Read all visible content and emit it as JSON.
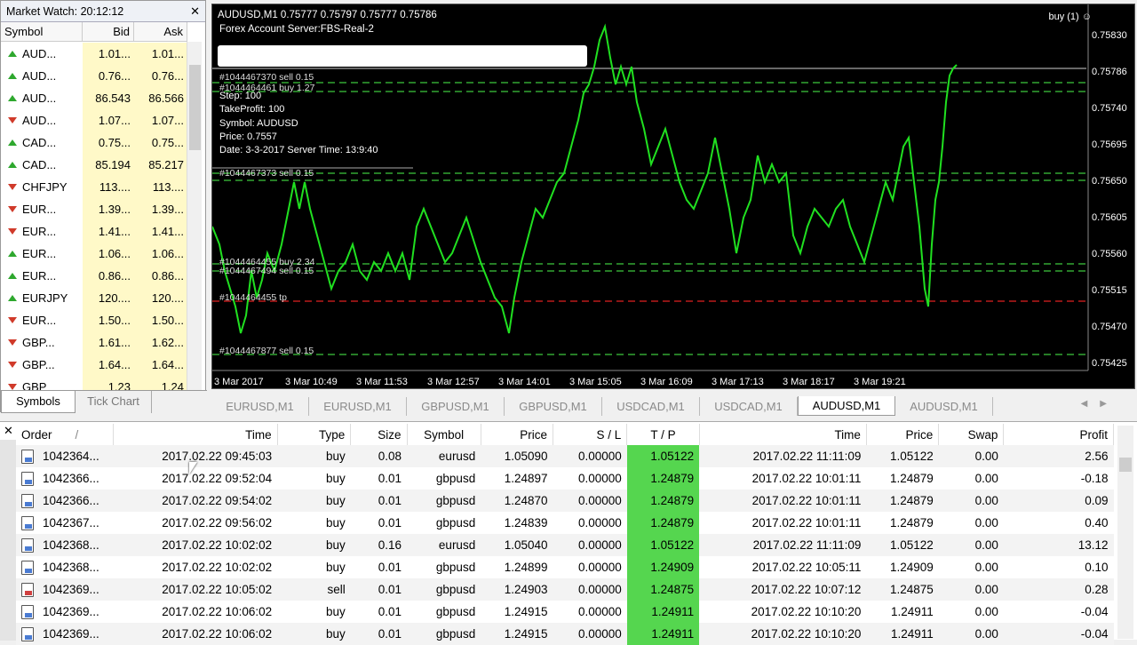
{
  "market_watch": {
    "title": "Market Watch: 20:12:12",
    "headers": {
      "symbol": "Symbol",
      "bid": "Bid",
      "ask": "Ask"
    },
    "rows": [
      {
        "symbol": "AUD...",
        "bid": "1.01...",
        "ask": "1.01...",
        "dir": "up"
      },
      {
        "symbol": "AUD...",
        "bid": "0.76...",
        "ask": "0.76...",
        "dir": "up"
      },
      {
        "symbol": "AUD...",
        "bid": "86.543",
        "ask": "86.566",
        "dir": "up"
      },
      {
        "symbol": "AUD...",
        "bid": "1.07...",
        "ask": "1.07...",
        "dir": "dn"
      },
      {
        "symbol": "CAD...",
        "bid": "0.75...",
        "ask": "0.75...",
        "dir": "up"
      },
      {
        "symbol": "CAD...",
        "bid": "85.194",
        "ask": "85.217",
        "dir": "up"
      },
      {
        "symbol": "CHFJPY",
        "bid": "113....",
        "ask": "113....",
        "dir": "dn"
      },
      {
        "symbol": "EUR...",
        "bid": "1.39...",
        "ask": "1.39...",
        "dir": "dn"
      },
      {
        "symbol": "EUR...",
        "bid": "1.41...",
        "ask": "1.41...",
        "dir": "dn"
      },
      {
        "symbol": "EUR...",
        "bid": "1.06...",
        "ask": "1.06...",
        "dir": "up"
      },
      {
        "symbol": "EUR...",
        "bid": "0.86...",
        "ask": "0.86...",
        "dir": "up"
      },
      {
        "symbol": "EURJPY",
        "bid": "120....",
        "ask": "120....",
        "dir": "up"
      },
      {
        "symbol": "EUR...",
        "bid": "1.50...",
        "ask": "1.50...",
        "dir": "dn"
      },
      {
        "symbol": "GBP...",
        "bid": "1.61...",
        "ask": "1.62...",
        "dir": "dn"
      },
      {
        "symbol": "GBP...",
        "bid": "1.64...",
        "ask": "1.64...",
        "dir": "dn"
      },
      {
        "symbol": "GBP",
        "bid": "1.23",
        "ask": "1.24",
        "dir": "dn"
      }
    ],
    "tabs": [
      "Symbols",
      "Tick Chart"
    ]
  },
  "chart": {
    "title": "AUDUSD,M1  0.75777 0.75797 0.75777 0.75786",
    "server": "Forex Account Server:FBS-Real-2",
    "buy_indicator": "buy (1) ☺",
    "info_lines": [
      "Step: 100",
      "TakeProfit: 100",
      "Symbol: AUDUSD",
      "Price: 0.7557",
      "Date: 3-3-2017 Server Time: 13:9:40"
    ],
    "order_labels": [
      {
        "text": "#1044467370 sell 0.15"
      },
      {
        "text": "#1044464461 buy 1.27"
      },
      {
        "text": "#1044467373 sell 0.15"
      },
      {
        "text": "#1044464455 buy 2.34"
      },
      {
        "text": "#1044467494 sell 0.15"
      },
      {
        "text": "#1044464455 tp"
      },
      {
        "text": "#1044467877 sell 0.15"
      }
    ],
    "price_labels": [
      "0.75830",
      "0.75786",
      "0.75740",
      "0.75695",
      "0.75650",
      "0.75605",
      "0.75560",
      "0.75515",
      "0.75470",
      "0.75425"
    ],
    "time_labels": [
      "3 Mar 2017",
      "3 Mar 10:49",
      "3 Mar 11:53",
      "3 Mar 12:57",
      "3 Mar 14:01",
      "3 Mar 15:05",
      "3 Mar 16:09",
      "3 Mar 17:13",
      "3 Mar 18:17",
      "3 Mar 19:21"
    ],
    "colors": {
      "line": "#20e020",
      "background": "#000000",
      "dashed_green": "#3cc83c",
      "dashed_red": "#e02020"
    }
  },
  "chart_tabs": [
    {
      "label": "EURUSD,M1",
      "active": false
    },
    {
      "label": "EURUSD,M1",
      "active": false
    },
    {
      "label": "GBPUSD,M1",
      "active": false
    },
    {
      "label": "GBPUSD,M1",
      "active": false
    },
    {
      "label": "USDCAD,M1",
      "active": false
    },
    {
      "label": "USDCAD,M1",
      "active": false
    },
    {
      "label": "AUDUSD,M1",
      "active": true
    },
    {
      "label": "AUDUSD,M1",
      "active": false
    }
  ],
  "terminal": {
    "headers": [
      "Order",
      "Time",
      "Type",
      "Size",
      "Symbol",
      "Price",
      "S / L",
      "T / P",
      "Time",
      "Price",
      "Swap",
      "Profit"
    ],
    "sort_indicator": "/",
    "rows": [
      [
        "1042364...",
        "2017.02.22 09:45:03",
        "buy",
        "0.08",
        "eurusd",
        "1.05090",
        "0.00000",
        "1.05122",
        "2017.02.22 11:11:09",
        "1.05122",
        "0.00",
        "2.56"
      ],
      [
        "1042366...",
        "2017.02.22 09:52:04",
        "buy",
        "0.01",
        "gbpusd",
        "1.24897",
        "0.00000",
        "1.24879",
        "2017.02.22 10:01:11",
        "1.24879",
        "0.00",
        "-0.18"
      ],
      [
        "1042366...",
        "2017.02.22 09:54:02",
        "buy",
        "0.01",
        "gbpusd",
        "1.24870",
        "0.00000",
        "1.24879",
        "2017.02.22 10:01:11",
        "1.24879",
        "0.00",
        "0.09"
      ],
      [
        "1042367...",
        "2017.02.22 09:56:02",
        "buy",
        "0.01",
        "gbpusd",
        "1.24839",
        "0.00000",
        "1.24879",
        "2017.02.22 10:01:11",
        "1.24879",
        "0.00",
        "0.40"
      ],
      [
        "1042368...",
        "2017.02.22 10:02:02",
        "buy",
        "0.16",
        "eurusd",
        "1.05040",
        "0.00000",
        "1.05122",
        "2017.02.22 11:11:09",
        "1.05122",
        "0.00",
        "13.12"
      ],
      [
        "1042368...",
        "2017.02.22 10:02:02",
        "buy",
        "0.01",
        "gbpusd",
        "1.24899",
        "0.00000",
        "1.24909",
        "2017.02.22 10:05:11",
        "1.24909",
        "0.00",
        "0.10"
      ],
      [
        "1042369...",
        "2017.02.22 10:05:02",
        "sell",
        "0.01",
        "gbpusd",
        "1.24903",
        "0.00000",
        "1.24875",
        "2017.02.22 10:07:12",
        "1.24875",
        "0.00",
        "0.28"
      ],
      [
        "1042369...",
        "2017.02.22 10:06:02",
        "buy",
        "0.01",
        "gbpusd",
        "1.24915",
        "0.00000",
        "1.24911",
        "2017.02.22 10:10:20",
        "1.24911",
        "0.00",
        "-0.04"
      ],
      [
        "1042369...",
        "2017.02.22 10:06:02",
        "buy",
        "0.01",
        "gbpusd",
        "1.24915",
        "0.00000",
        "1.24911",
        "2017.02.22 10:10:20",
        "1.24911",
        "0.00",
        "-0.04"
      ]
    ]
  }
}
